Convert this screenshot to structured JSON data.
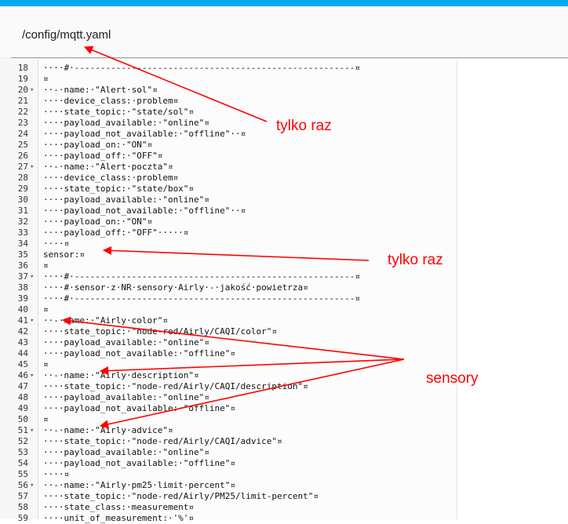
{
  "header": {
    "file_path": "/config/mqtt.yaml"
  },
  "editor": {
    "lines": [
      {
        "n": "18",
        "text": "····#·------------------------------------------------------¤",
        "fold": ""
      },
      {
        "n": "19",
        "text": "¤",
        "fold": ""
      },
      {
        "n": "20",
        "text": "··-·name:·\"Alert·sol\"¤",
        "fold": "▾"
      },
      {
        "n": "21",
        "text": "····device_class:·problem¤",
        "fold": ""
      },
      {
        "n": "22",
        "text": "····state_topic:·\"state/sol\"¤",
        "fold": ""
      },
      {
        "n": "23",
        "text": "····payload_available:·\"online\"¤",
        "fold": ""
      },
      {
        "n": "24",
        "text": "····payload_not_available:·\"offline\"··¤",
        "fold": ""
      },
      {
        "n": "25",
        "text": "····payload_on:·\"ON\"¤",
        "fold": ""
      },
      {
        "n": "26",
        "text": "····payload_off:·\"OFF\"¤",
        "fold": ""
      },
      {
        "n": "27",
        "text": "··-·name:·\"Alert·poczta\"¤",
        "fold": "▾"
      },
      {
        "n": "28",
        "text": "····device_class:·problem¤",
        "fold": ""
      },
      {
        "n": "29",
        "text": "····state_topic:·\"state/box\"¤",
        "fold": ""
      },
      {
        "n": "30",
        "text": "····payload_available:·\"online\"¤",
        "fold": ""
      },
      {
        "n": "31",
        "text": "····payload_not_available:·\"offline\"··¤",
        "fold": ""
      },
      {
        "n": "32",
        "text": "····payload_on:·\"ON\"¤",
        "fold": ""
      },
      {
        "n": "33",
        "text": "····payload_off:·\"OFF\"·····¤",
        "fold": ""
      },
      {
        "n": "34",
        "text": "····¤",
        "fold": ""
      },
      {
        "n": "35",
        "text": "sensor:¤",
        "fold": ""
      },
      {
        "n": "36",
        "text": "¤",
        "fold": ""
      },
      {
        "n": "37",
        "text": "····#·------------------------------------------------------¤",
        "fold": "▾"
      },
      {
        "n": "38",
        "text": "····#·sensor·z·NR·sensory·Airly·-·jakość·powietrza¤",
        "fold": ""
      },
      {
        "n": "39",
        "text": "····#·------------------------------------------------------¤",
        "fold": ""
      },
      {
        "n": "40",
        "text": "¤",
        "fold": ""
      },
      {
        "n": "41",
        "text": "··-·name:·\"Airly·color\"¤",
        "fold": "▾"
      },
      {
        "n": "42",
        "text": "····state_topic:·\"node-red/Airly/CAQI/color\"¤",
        "fold": ""
      },
      {
        "n": "43",
        "text": "····payload_available:·\"online\"¤",
        "fold": ""
      },
      {
        "n": "44",
        "text": "····payload_not_available:·\"offline\"¤",
        "fold": ""
      },
      {
        "n": "45",
        "text": "¤",
        "fold": ""
      },
      {
        "n": "46",
        "text": "··-·name:·\"Airly·description\"¤",
        "fold": "▾"
      },
      {
        "n": "47",
        "text": "····state_topic:·\"node-red/Airly/CAQI/description\"¤",
        "fold": ""
      },
      {
        "n": "48",
        "text": "····payload_available:·\"online\"¤",
        "fold": ""
      },
      {
        "n": "49",
        "text": "····payload_not_available:·\"offline\"¤",
        "fold": ""
      },
      {
        "n": "50",
        "text": "¤",
        "fold": ""
      },
      {
        "n": "51",
        "text": "··-·name:·\"Airly·advice\"¤",
        "fold": "▾"
      },
      {
        "n": "52",
        "text": "····state_topic:·\"node-red/Airly/CAQI/advice\"¤",
        "fold": ""
      },
      {
        "n": "53",
        "text": "····payload_available:·\"online\"¤",
        "fold": ""
      },
      {
        "n": "54",
        "text": "····payload_not_available:·\"offline\"¤",
        "fold": ""
      },
      {
        "n": "55",
        "text": "····¤",
        "fold": ""
      },
      {
        "n": "56",
        "text": "··-·name:·\"Airly·pm25·limit·percent\"¤",
        "fold": "▾"
      },
      {
        "n": "57",
        "text": "····state_topic:·\"node-red/Airly/PM25/limit-percent\"¤",
        "fold": ""
      },
      {
        "n": "58",
        "text": "····state_class:·measurement¤",
        "fold": ""
      },
      {
        "n": "59",
        "text": "····unit_of_measurement:·'%'¤",
        "fold": ""
      }
    ]
  },
  "annotations": {
    "label_once_1": "tylko raz",
    "label_once_2": "tylko raz",
    "label_sensors": "sensory",
    "color": "#ff0000"
  }
}
